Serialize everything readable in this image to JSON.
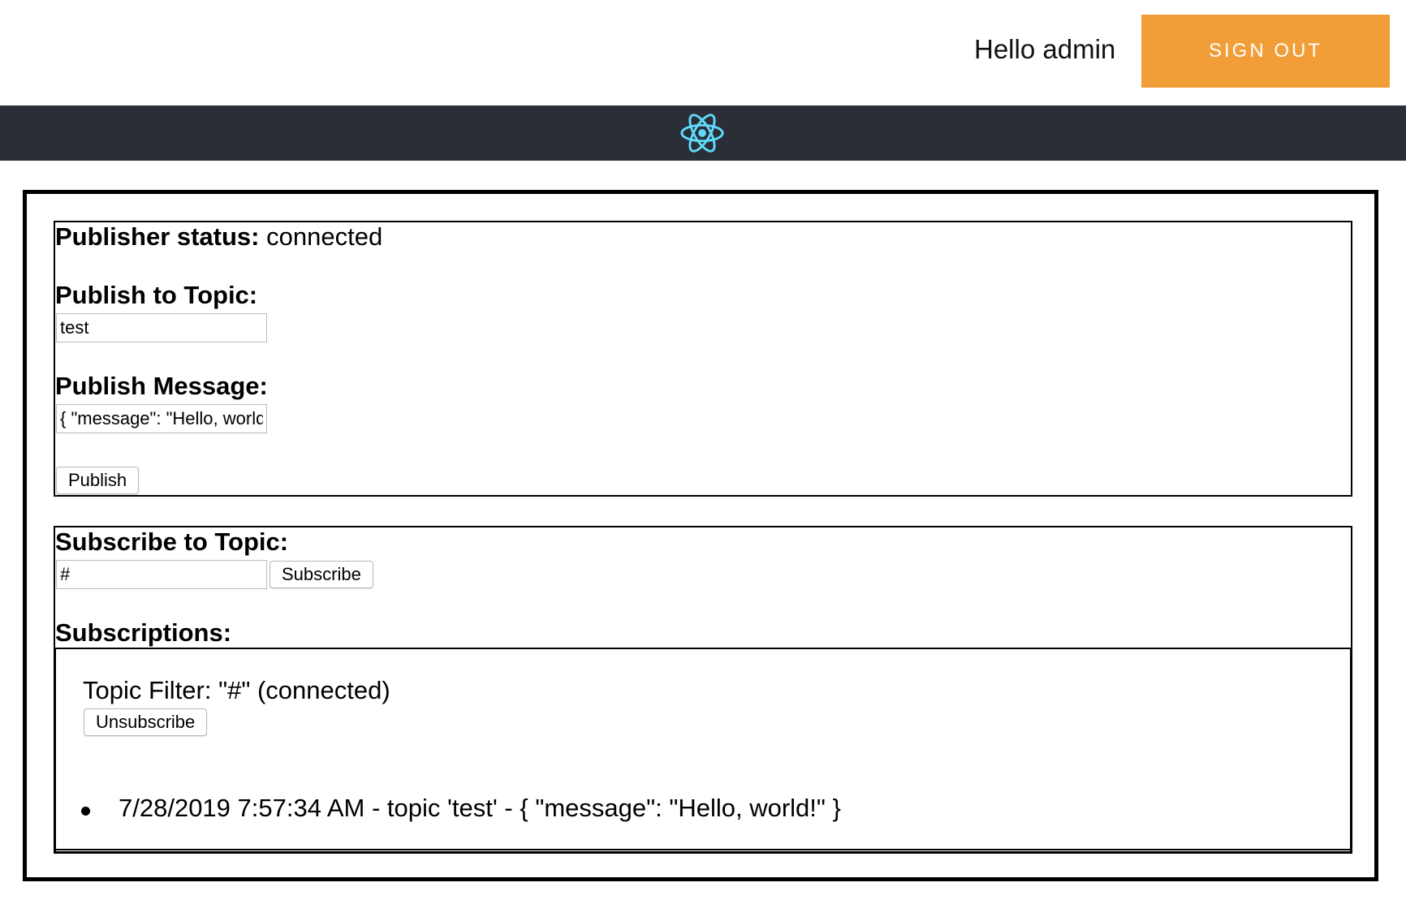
{
  "header": {
    "greeting": "Hello admin",
    "sign_out_label": "SIGN OUT",
    "sign_out_color": "#f29e38",
    "band_color": "#2a2e36",
    "logo_icon": "react-atom-icon",
    "logo_color": "#61dafb"
  },
  "publisher": {
    "status_label": "Publisher status:",
    "status_value": "connected",
    "topic_label": "Publish to Topic:",
    "topic_value": "test",
    "message_label": "Publish Message:",
    "message_value": "{ \"message\": \"Hello, world!\" }",
    "publish_button": "Publish"
  },
  "subscriber": {
    "topic_label": "Subscribe to Topic:",
    "topic_value": "#",
    "subscribe_button": "Subscribe",
    "subscriptions_label": "Subscriptions:",
    "subscriptions": [
      {
        "filter_text": "Topic Filter: \"#\" (connected)",
        "unsubscribe_button": "Unsubscribe",
        "messages": [
          "7/28/2019 7:57:34 AM - topic 'test' - { \"message\": \"Hello, world!\" }"
        ]
      }
    ]
  }
}
